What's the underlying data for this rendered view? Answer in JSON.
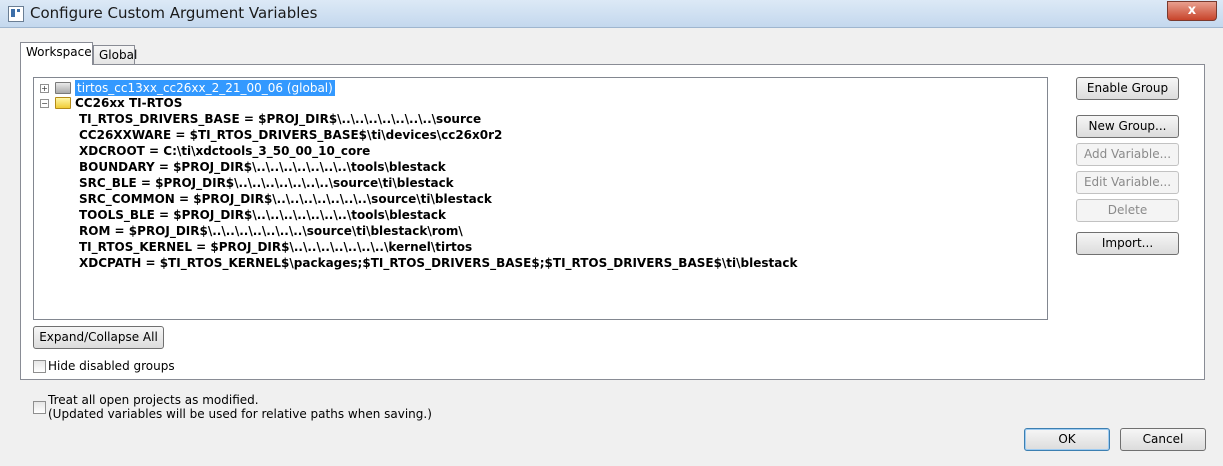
{
  "window": {
    "title": "Configure Custom Argument Variables",
    "close_label": "x"
  },
  "tabs": [
    {
      "label": "Workspace",
      "active": true
    },
    {
      "label": "Global",
      "active": false
    }
  ],
  "tree": {
    "groups": [
      {
        "label": "tirtos_cc13xx_cc26xx_2_21_00_06 (global)",
        "expanded": false,
        "selected": true,
        "icon": "grey-folder-icon"
      },
      {
        "label": "CC26xx TI-RTOS",
        "expanded": true,
        "selected": false,
        "icon": "folder-icon"
      }
    ],
    "variables": [
      "TI_RTOS_DRIVERS_BASE  =  $PROJ_DIR$\\..\\..\\..\\..\\..\\..\\..\\source",
      "CC26XXWARE  =  $TI_RTOS_DRIVERS_BASE$\\ti\\devices\\cc26x0r2",
      "XDCROOT  =  C:\\ti\\xdctools_3_50_00_10_core",
      "BOUNDARY  =  $PROJ_DIR$\\..\\..\\..\\..\\..\\..\\..\\tools\\blestack",
      "SRC_BLE  =  $PROJ_DIR$\\..\\..\\..\\..\\..\\..\\..\\source\\ti\\blestack",
      "SRC_COMMON  =  $PROJ_DIR$\\..\\..\\..\\..\\..\\..\\..\\source\\ti\\blestack",
      "TOOLS_BLE  =  $PROJ_DIR$\\..\\..\\..\\..\\..\\..\\..\\tools\\blestack",
      "ROM  =  $PROJ_DIR$\\..\\..\\..\\..\\..\\..\\..\\source\\ti\\blestack\\rom\\",
      "TI_RTOS_KERNEL  =  $PROJ_DIR$\\..\\..\\..\\..\\..\\..\\..\\kernel\\tirtos",
      "XDCPATH  =  $TI_RTOS_KERNEL$\\packages;$TI_RTOS_DRIVERS_BASE$;$TI_RTOS_DRIVERS_BASE$\\ti\\blestack"
    ]
  },
  "side_buttons": {
    "enable_group": {
      "label": "Enable Group",
      "enabled": true
    },
    "new_group": {
      "label": "New Group...",
      "enabled": true
    },
    "add_variable": {
      "label": "Add Variable...",
      "enabled": false
    },
    "edit_variable": {
      "label": "Edit Variable...",
      "enabled": false
    },
    "delete": {
      "label": "Delete",
      "enabled": false
    },
    "import": {
      "label": "Import...",
      "enabled": true
    }
  },
  "expand_collapse_label": "Expand/Collapse All",
  "hide_disabled": {
    "label": "Hide disabled groups",
    "checked": false
  },
  "treat_modified": {
    "label": "Treat all open projects as modified.",
    "note": "(Updated variables will be used for relative paths when saving.)",
    "checked": false
  },
  "dialog_buttons": {
    "ok": "OK",
    "cancel": "Cancel"
  },
  "colors": {
    "selection": "#3399ff",
    "folder": "#f0cc35",
    "title_bar": "#c4d8ee"
  }
}
